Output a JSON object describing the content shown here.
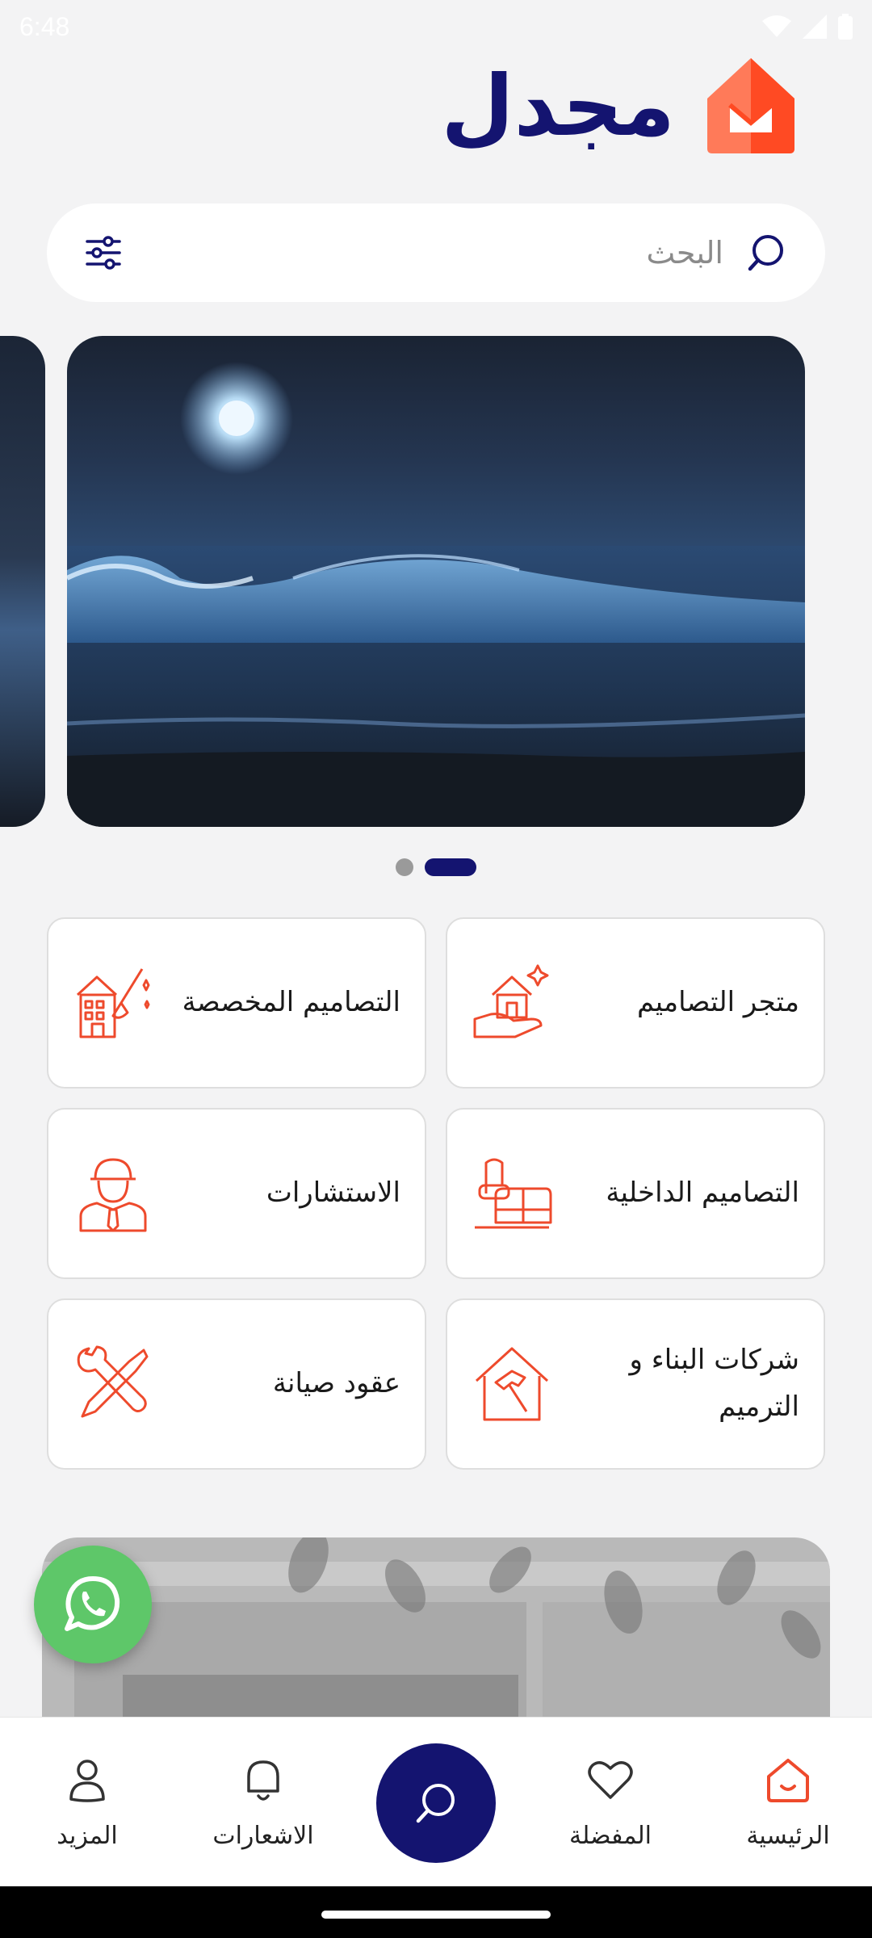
{
  "status_bar": {
    "time": "6:48"
  },
  "brand": {
    "name": "مجدل",
    "logo_icon": "house-logo-icon"
  },
  "search": {
    "placeholder": "البحث"
  },
  "carousel": {
    "slides": 2,
    "active_index": 1
  },
  "services": [
    {
      "label": "متجر التصاميم",
      "icon": "house-hand-icon"
    },
    {
      "label": "التصاميم المخصصة",
      "icon": "building-brush-icon"
    },
    {
      "label": "التصاميم الداخلية",
      "icon": "sofa-icon"
    },
    {
      "label": "الاستشارات",
      "icon": "engineer-icon"
    },
    {
      "label": "شركات البناء و الترميم",
      "icon": "house-hammer-icon"
    },
    {
      "label": "عقود صيانة",
      "icon": "wrench-screwdriver-icon"
    }
  ],
  "bottom_nav": {
    "home": "الرئيسية",
    "favorites": "المفضلة",
    "notifications": "الاشعارات",
    "more": "المزيد"
  },
  "colors": {
    "brand_navy": "#141470",
    "accent_orange": "#ee4a2c",
    "whatsapp_green": "#5ec769",
    "background": "#f3f3f4"
  }
}
